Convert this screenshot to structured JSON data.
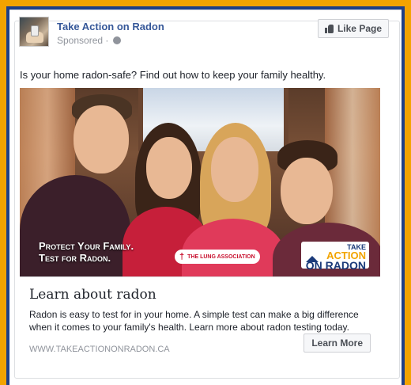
{
  "post": {
    "page_name": "Take Action on Radon",
    "sponsored_label": "Sponsored · ",
    "globe_icon": "globe-icon",
    "like_page_label": "Like Page",
    "like_icon": "thumbs-up-icon",
    "text": "Is your home radon-safe? Find out how to keep your family healthy."
  },
  "hero": {
    "tagline_line1": "Protect Your Family.",
    "tagline_line2": "Test for Radon.",
    "lung_badge": "THE LUNG ASSOCIATION",
    "logo_line1": "TAKE",
    "logo_line2": "ACTION",
    "logo_line3": "ON RADON"
  },
  "link": {
    "title": "Learn about radon",
    "description": "Radon is easy to test for in your home. A simple test can make a big difference when it comes to your family's health. Learn more about radon testing today.",
    "url": "WWW.TAKEACTIONONRADON.CA",
    "cta_label": "Learn More"
  },
  "colors": {
    "frame_orange": "#f3a300",
    "frame_blue": "#1f3f86",
    "link_blue": "#365899"
  }
}
